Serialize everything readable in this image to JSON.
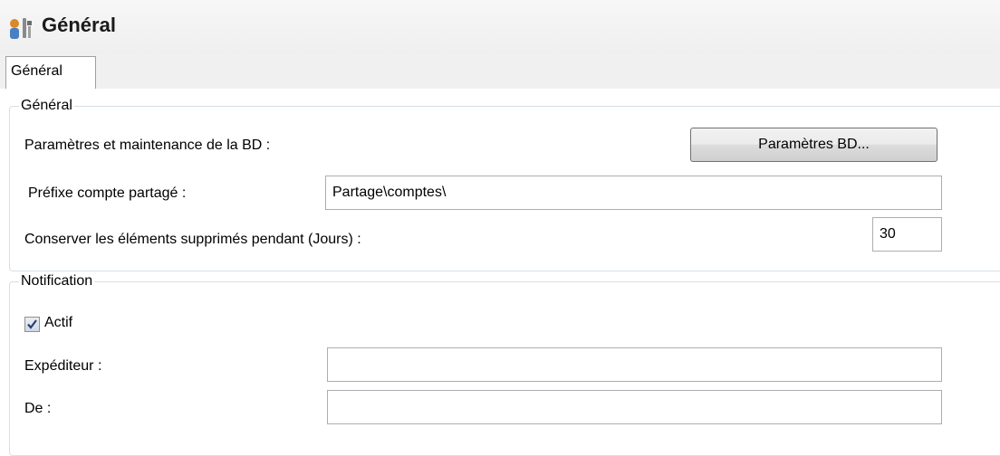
{
  "header": {
    "title": "Général",
    "icon": "settings-tools-icon"
  },
  "tabs": [
    {
      "label": "Général",
      "active": true
    }
  ],
  "general_group": {
    "legend": "Général",
    "db_label": "Paramètres et maintenance de la BD :",
    "db_button": "Paramètres BD...",
    "prefix_label": "Préfixe compte partagé :",
    "prefix_value": "Partage\\comptes\\",
    "retain_label": "Conserver les éléments supprimés pendant (Jours) :",
    "retain_value": "30"
  },
  "notification_group": {
    "legend": "Notification",
    "active_label": "Actif",
    "active_checked": true,
    "sender_label": "Expéditeur :",
    "sender_value": "",
    "from_label": "De :",
    "from_value": ""
  }
}
